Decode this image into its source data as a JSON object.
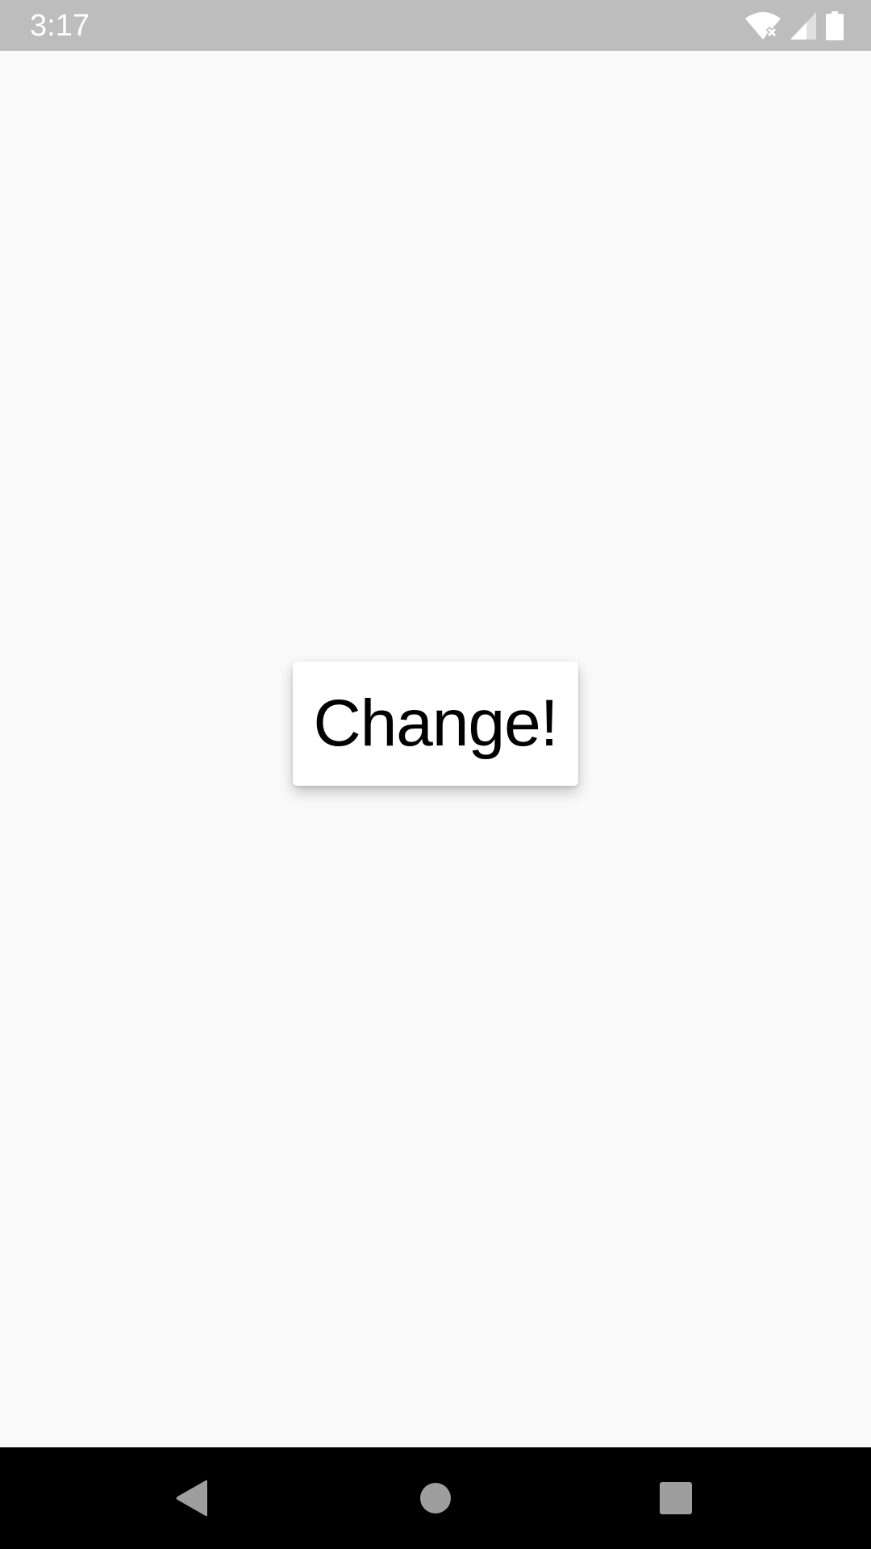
{
  "status_bar": {
    "time": "3:17",
    "icons": [
      "wifi-no-internet-icon",
      "cell-signal-icon",
      "battery-icon"
    ]
  },
  "main": {
    "button_label": "Change!"
  },
  "nav_bar": {
    "buttons": [
      "back-icon",
      "home-icon",
      "recents-icon"
    ]
  },
  "colors": {
    "status_bar_bg": "#bdbdbd",
    "content_bg": "#fafafa",
    "button_bg": "#ffffff",
    "nav_bar_bg": "#000000",
    "nav_icon": "#9e9e9e"
  }
}
